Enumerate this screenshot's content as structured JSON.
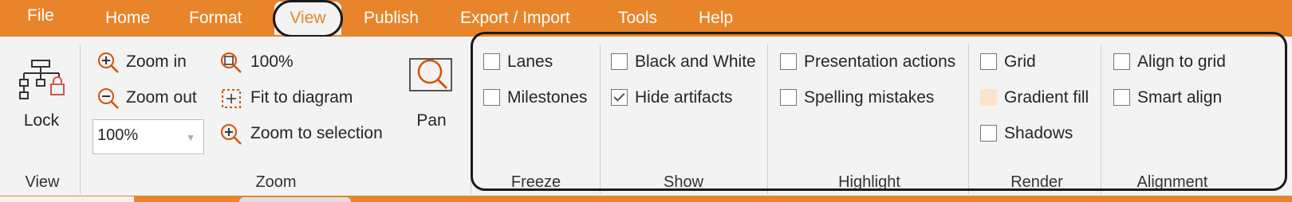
{
  "tabs": {
    "file": "File",
    "home": "Home",
    "format": "Format",
    "view": "View",
    "publish": "Publish",
    "export_import": "Export / Import",
    "tools": "Tools",
    "help": "Help"
  },
  "groups": {
    "view": {
      "label": "View",
      "lock_label": "Lock"
    },
    "zoom": {
      "label": "Zoom",
      "zoom_in": "Zoom in",
      "zoom_out": "Zoom out",
      "zoom_value": "100%",
      "actual_size": "100%",
      "fit_to_diagram": "Fit to diagram",
      "zoom_to_selection": "Zoom to selection",
      "pan": "Pan"
    },
    "freeze": {
      "label": "Freeze",
      "lanes": "Lanes",
      "milestones": "Milestones"
    },
    "show": {
      "label": "Show",
      "black_and_white": "Black and White",
      "hide_artifacts": "Hide artifacts"
    },
    "highlight": {
      "label": "Highlight",
      "presentation_actions": "Presentation actions",
      "spelling_mistakes": "Spelling mistakes"
    },
    "render": {
      "label": "Render",
      "grid": "Grid",
      "gradient_fill": "Gradient fill",
      "shadows": "Shadows"
    },
    "alignment": {
      "label": "Alignment",
      "align_to_grid": "Align to grid",
      "smart_align": "Smart align"
    }
  },
  "checked": {
    "lanes": false,
    "milestones": false,
    "black_and_white": false,
    "hide_artifacts": true,
    "presentation_actions": false,
    "spelling_mistakes": false,
    "grid": false,
    "gradient_fill": false,
    "shadows": false,
    "align_to_grid": false,
    "smart_align": false
  },
  "colors": {
    "accent": "#e8842a",
    "ribbon_bg": "#f3f3f3",
    "gradient_highlight": "#fde3cc",
    "icon_red": "#d9534f"
  }
}
